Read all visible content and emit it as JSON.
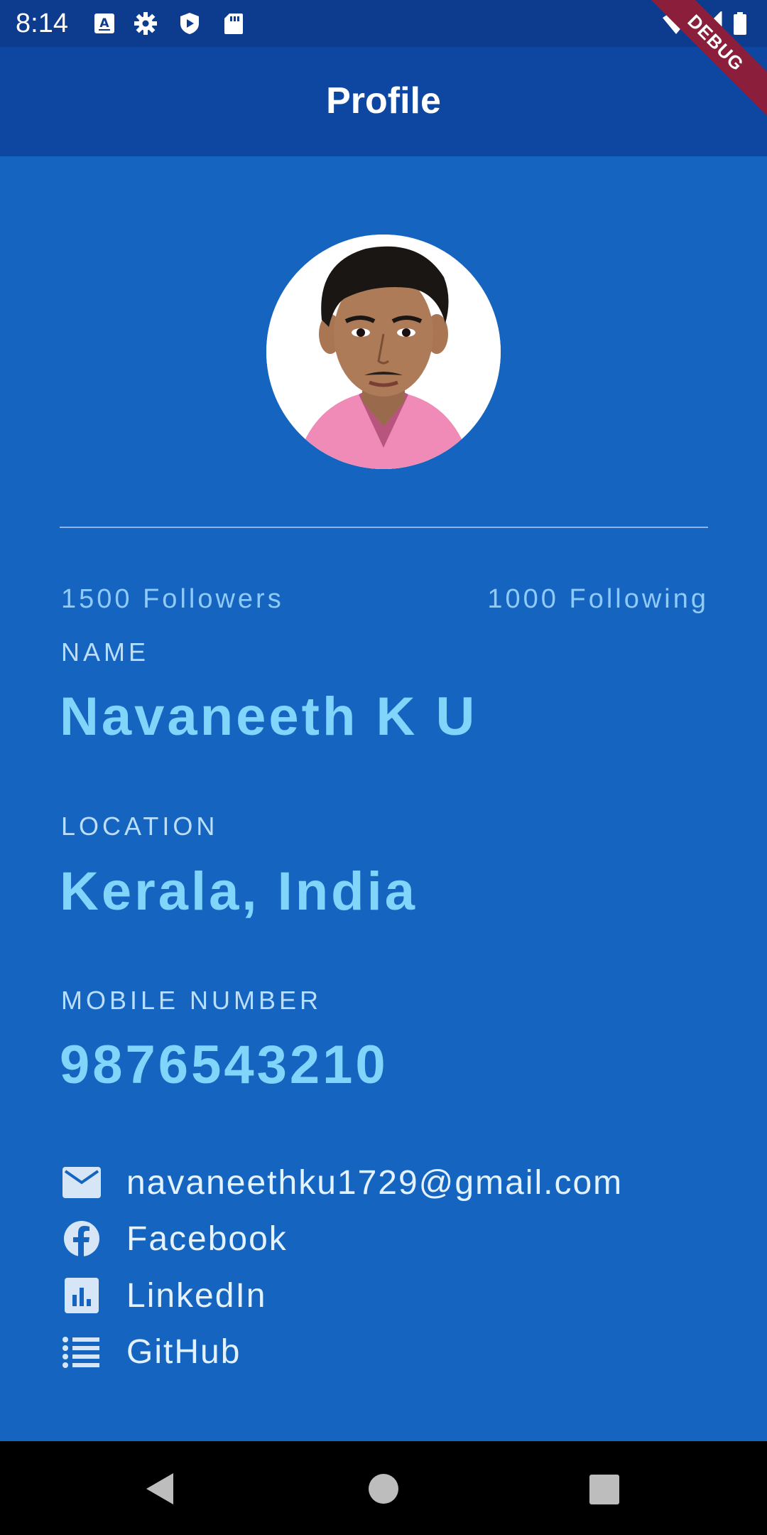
{
  "status_bar": {
    "time": "8:14",
    "icons": [
      "text-a-icon",
      "gear-icon",
      "play-protect-icon",
      "sd-card-icon",
      "wifi-icon",
      "signal-icon",
      "battery-icon"
    ]
  },
  "app_bar": {
    "title": "Profile"
  },
  "debug_banner": {
    "label": "DEBUG"
  },
  "profile": {
    "followers": "1500 Followers",
    "following": "1000 Following",
    "name_label": "NAME",
    "name_value": "Navaneeth K U",
    "location_label": "LOCATION",
    "location_value": "Kerala, India",
    "mobile_label": "MOBILE NUMBER",
    "mobile_value": "9876543210"
  },
  "contacts": [
    {
      "icon": "mail-icon",
      "label": "navaneethku1729@gmail.com"
    },
    {
      "icon": "facebook-icon",
      "label": "Facebook"
    },
    {
      "icon": "linkedin-icon",
      "label": "LinkedIn"
    },
    {
      "icon": "github-list-icon",
      "label": "GitHub"
    }
  ],
  "colors": {
    "status_bar": "#0D3B8E",
    "app_bar": "#0D47A1",
    "background": "#1565C0",
    "value_text": "#81D4FA",
    "label_text": "#BBDEFB",
    "debug_banner": "#8B1E3A"
  },
  "nav_bar": {
    "buttons": [
      "back-icon",
      "home-icon",
      "recents-icon"
    ]
  }
}
